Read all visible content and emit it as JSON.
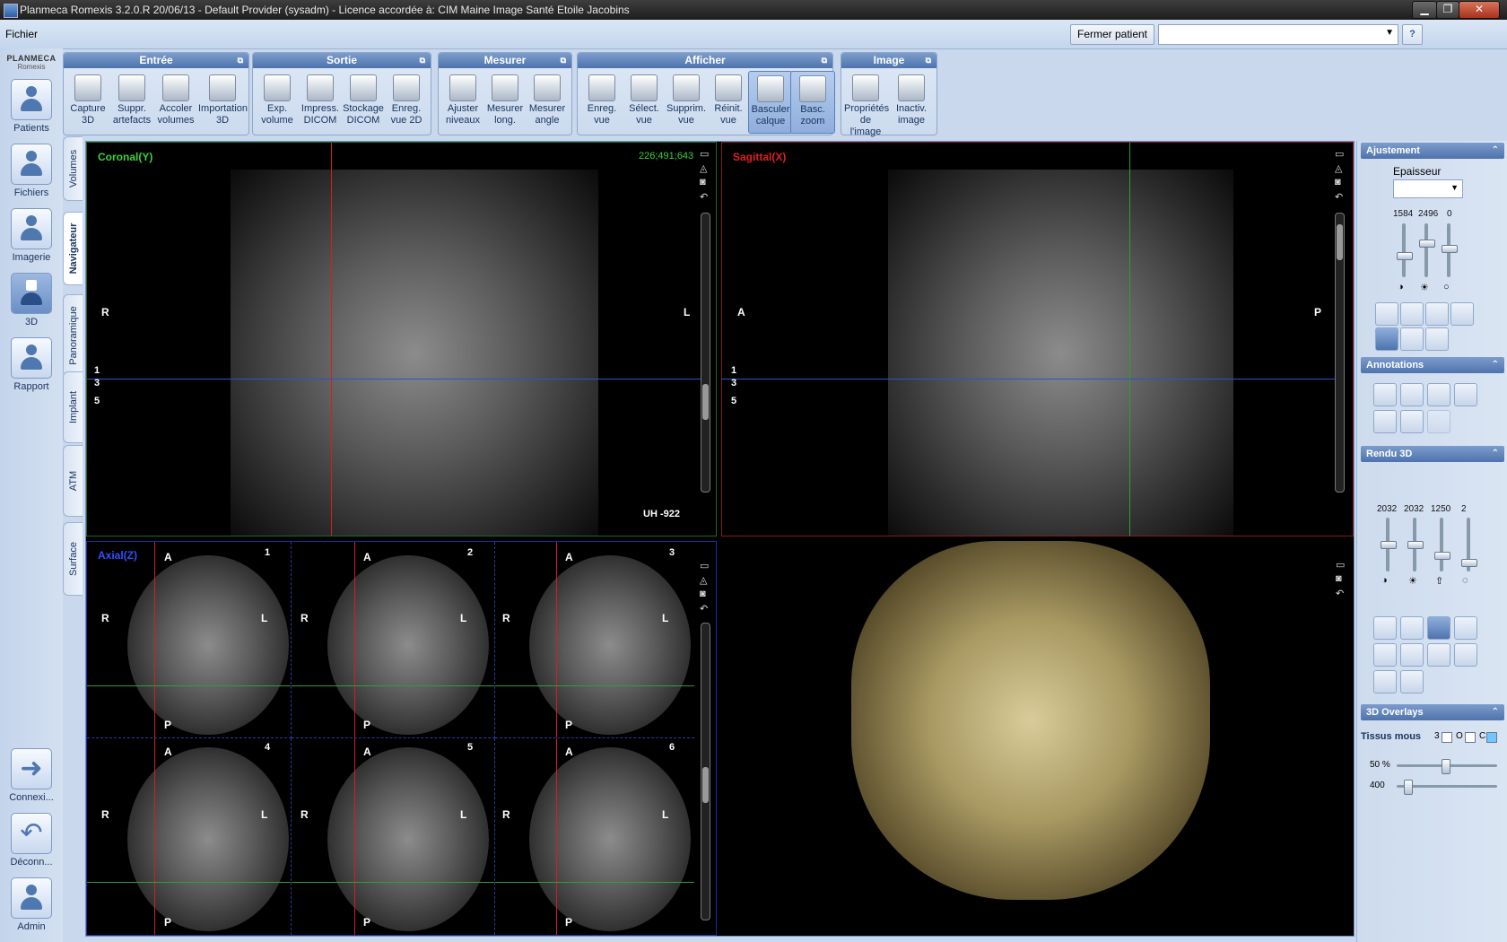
{
  "window": {
    "title": "Planmeca Romexis 3.2.0.R  20/06/13 - Default Provider (sysadm) - Licence accordée à: CIM Maine Image Santé Etoile Jacobins"
  },
  "menu": {
    "file": "Fichier",
    "close_patient": "Fermer patient"
  },
  "brand": {
    "name": "PLANMECA",
    "sub": "Romexis"
  },
  "leftnav": {
    "patients": "Patients",
    "files": "Fichiers",
    "imaging": "Imagerie",
    "three_d": "3D",
    "report": "Rapport",
    "connect": "Connexi...",
    "disconnect": "Déconn...",
    "admin": "Admin"
  },
  "tabs": {
    "volumes": "Volumes",
    "navigator": "Navigateur",
    "panoramic": "Panoramique",
    "implant": "Implant",
    "atm": "ATM",
    "surface": "Surface"
  },
  "ribbon": {
    "entree": {
      "title": "Entrée",
      "b1": [
        "Capture",
        "3D"
      ],
      "b2": [
        "Suppr.",
        "artefacts"
      ],
      "b3": [
        "Accoler",
        "volumes"
      ],
      "b4": [
        "Importation",
        "3D"
      ]
    },
    "sortie": {
      "title": "Sortie",
      "b1": [
        "Exp.",
        "volume"
      ],
      "b2": [
        "Impress.",
        "DICOM"
      ],
      "b3": [
        "Stockage",
        "DICOM"
      ],
      "b4": [
        "Enreg.",
        "vue 2D"
      ]
    },
    "mesurer": {
      "title": "Mesurer",
      "b1": [
        "Ajuster",
        "niveaux"
      ],
      "b2": [
        "Mesurer",
        "long."
      ],
      "b3": [
        "Mesurer",
        "angle"
      ]
    },
    "afficher": {
      "title": "Afficher",
      "b1": [
        "Enreg.",
        "vue"
      ],
      "b2": [
        "Sélect.",
        "vue"
      ],
      "b3": [
        "Supprim.",
        "vue"
      ],
      "b4": [
        "Réinit.",
        "vue"
      ],
      "b5": [
        "Basculer",
        "calque"
      ],
      "b6": [
        "Basc.",
        "zoom"
      ]
    },
    "image": {
      "title": "Image",
      "b1": [
        "Propriétés",
        "de l'image"
      ],
      "b2": [
        "Inactiv.",
        "image"
      ]
    }
  },
  "coronal": {
    "label": "Coronal(Y)",
    "coords": "226;491;643",
    "left": "R",
    "right": "L",
    "hu": "UH -922",
    "marks": [
      "1",
      "3",
      "5"
    ]
  },
  "sagittal": {
    "label": "Sagittal(X)",
    "left": "A",
    "right": "P",
    "marks": [
      "1",
      "3",
      "5"
    ]
  },
  "axial": {
    "label": "Axial(Z)",
    "anterior": "A",
    "posterior": "P",
    "right": "R",
    "left": "L",
    "slices": [
      "1",
      "2",
      "3",
      "4",
      "5",
      "6"
    ]
  },
  "right_panel": {
    "ajustement": {
      "title": "Ajustement",
      "thickness_label": "Epaisseur",
      "values": [
        "1584",
        "2496",
        "0"
      ]
    },
    "annotations": {
      "title": "Annotations"
    },
    "rendu": {
      "title": "Rendu 3D",
      "values": [
        "2032",
        "2032",
        "1250",
        "2"
      ]
    },
    "overlays": {
      "title": "3D Overlays",
      "soft_tissue": "Tissus mous",
      "opt1": "3",
      "opt2": "O",
      "opt3": "C",
      "pct": "50 %",
      "val": "400"
    }
  },
  "colors": {
    "accent": "#4e73ad",
    "coronal": "#39d23a",
    "sagittal": "#e02020",
    "axial": "#3050ff"
  }
}
